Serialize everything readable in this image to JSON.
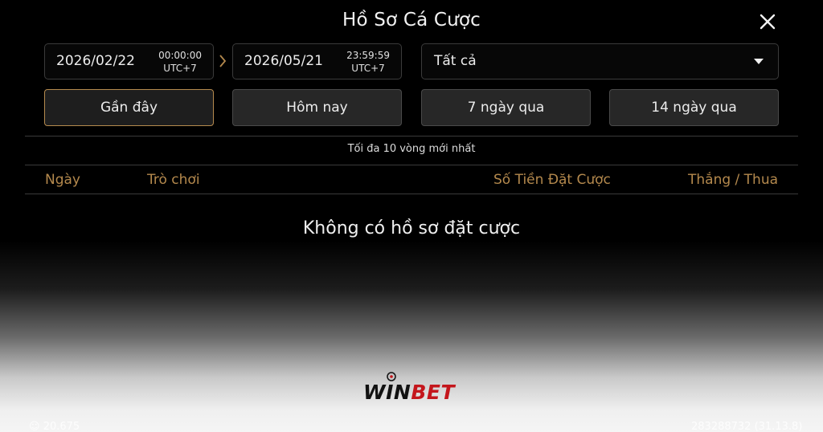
{
  "header": {
    "title": "Hồ Sơ Cá Cược"
  },
  "filters": {
    "start": {
      "date": "2026/02/22",
      "time": "00:00:00",
      "tz": "UTC+7"
    },
    "end": {
      "date": "2026/05/21",
      "time": "23:59:59",
      "tz": "UTC+7"
    },
    "type_select": {
      "value": "Tất cả"
    }
  },
  "quick_ranges": [
    {
      "label": "Gần đây",
      "active": true
    },
    {
      "label": "Hôm nay",
      "active": false
    },
    {
      "label": "7 ngày qua",
      "active": false
    },
    {
      "label": "14 ngày qua",
      "active": false
    }
  ],
  "note": "Tối đa 10 vòng mới nhất",
  "table": {
    "columns": [
      "Ngày",
      "Trò chơi",
      "Số Tiền Đặt Cược",
      "Thắng / Thua"
    ],
    "empty_text": "Không có hồ sơ đặt cược"
  },
  "brand": {
    "part1": "WIN",
    "part2": "BET"
  },
  "footer": {
    "left": "20.675",
    "right": "283288732 (31.13.8)"
  },
  "colors": {
    "accent": "#b4894d",
    "active_border": "#b58a4e",
    "brand_red": "#c4161c"
  }
}
